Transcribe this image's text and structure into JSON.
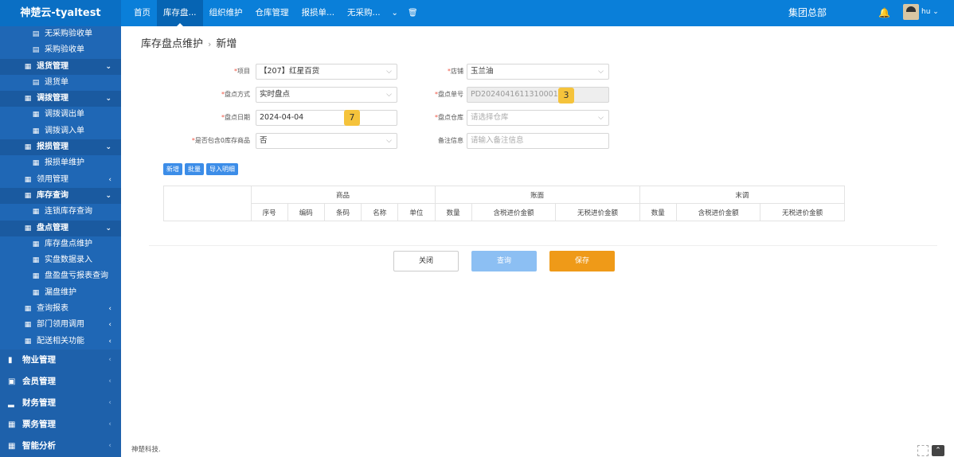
{
  "app": {
    "title": "神楚云-tyaltest"
  },
  "topnav": {
    "items": [
      "首页",
      "库存盘...",
      "组织维护",
      "仓库管理",
      "报损单...",
      "无采购..."
    ],
    "org": "集团总部",
    "user": "hu"
  },
  "sidebar": {
    "rows": [
      {
        "label": "无采购验收单",
        "icon": "doc-icon",
        "level": "l2"
      },
      {
        "label": "采购验收单",
        "icon": "doc-icon",
        "level": "l2"
      },
      {
        "label": "退货管理",
        "icon": "grid-icon",
        "level": "l1",
        "group": true,
        "arrow": "down"
      },
      {
        "label": "退货单",
        "icon": "doc-icon",
        "level": "l2"
      },
      {
        "label": "调拨管理",
        "icon": "grid-icon",
        "level": "l1",
        "group": true,
        "arrow": "down"
      },
      {
        "label": "调拨调出单",
        "icon": "grid-icon",
        "level": "l2"
      },
      {
        "label": "调拨调入单",
        "icon": "grid-icon",
        "level": "l2"
      },
      {
        "label": "报损管理",
        "icon": "grid-icon",
        "level": "l1",
        "group": true,
        "arrow": "down"
      },
      {
        "label": "报损单维护",
        "icon": "grid-icon",
        "level": "l2"
      },
      {
        "label": "领用管理",
        "icon": "grid-icon",
        "level": "l1",
        "arrow": "left"
      },
      {
        "label": "库存查询",
        "icon": "grid-icon",
        "level": "l1",
        "group": true,
        "arrow": "down"
      },
      {
        "label": "连锁库存查询",
        "icon": "grid-icon",
        "level": "l2"
      },
      {
        "label": "盘点管理",
        "icon": "grid-icon",
        "level": "l1",
        "group": true,
        "arrow": "down"
      },
      {
        "label": "库存盘点维护",
        "icon": "grid-icon",
        "level": "l2"
      },
      {
        "label": "实盘数据录入",
        "icon": "grid-icon",
        "level": "l2"
      },
      {
        "label": "盘盈盘亏报表查询",
        "icon": "grid-icon",
        "level": "l2"
      },
      {
        "label": "漏盘维护",
        "icon": "grid-icon",
        "level": "l2"
      },
      {
        "label": "查询报表",
        "icon": "grid-icon",
        "level": "l1",
        "arrow": "left"
      },
      {
        "label": "部门领用调用",
        "icon": "grid-icon",
        "level": "l1",
        "arrow": "left"
      },
      {
        "label": "配送相关功能",
        "icon": "grid-icon",
        "level": "l1",
        "arrow": "left"
      }
    ],
    "top": [
      {
        "label": "物业管理",
        "icon": "briefcase-icon"
      },
      {
        "label": "会员管理",
        "icon": "member-icon"
      },
      {
        "label": "财务管理",
        "icon": "bar-icon"
      },
      {
        "label": "票务管理",
        "icon": "grid-icon"
      },
      {
        "label": "智能分析",
        "icon": "grid-icon"
      }
    ]
  },
  "breadcrumb": {
    "parent": "库存盘点维护",
    "current": "新增"
  },
  "form": {
    "project_label": "项目",
    "project_value": "【207】红星百货",
    "shop_label": "店铺",
    "shop_value": "玉兰油",
    "method_label": "盘点方式",
    "method_value": "实时盘点",
    "docno_label": "盘点单号",
    "docno_value": "PD2024041611310001",
    "date_label": "盘点日期",
    "date_value": "2024-04-04",
    "warehouse_label": "盘点仓库",
    "warehouse_placeholder": "请选择仓库",
    "zero_label": "是否包含0库存商品",
    "zero_value": "否",
    "remark_label": "备注信息",
    "remark_placeholder": "请输入备注信息",
    "badge_docno": "3",
    "badge_date": "7"
  },
  "actions": {
    "add": "新增",
    "batch": "批量",
    "import": "导入明细"
  },
  "table": {
    "group_headers": [
      "商品",
      "账面",
      "末调"
    ],
    "columns": [
      "序号",
      "编码",
      "条码",
      "名称",
      "单位",
      "数量",
      "含税进价金额",
      "无税进价金额",
      "数量",
      "含税进价金额",
      "无税进价金额"
    ]
  },
  "buttons": {
    "close": "关闭",
    "query": "查询",
    "save": "保存"
  },
  "footer": {
    "text": "神楚科技."
  }
}
